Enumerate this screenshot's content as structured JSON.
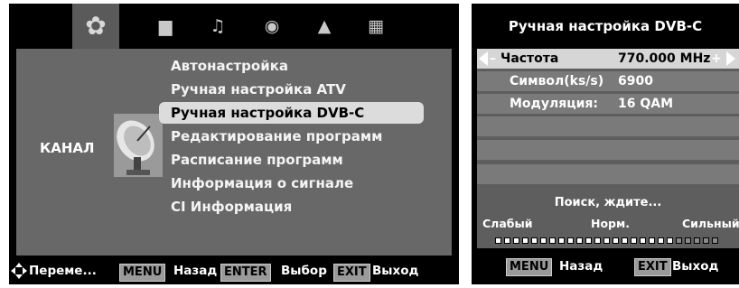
{
  "menu_screen": {
    "tabs": [
      {
        "icon": "gear-icon",
        "glyph": "✿",
        "active": true
      },
      {
        "icon": "monitor-icon",
        "glyph": "▆",
        "active": false
      },
      {
        "icon": "music-icon",
        "glyph": "♫",
        "active": false
      },
      {
        "icon": "clock-icon",
        "glyph": "◉",
        "active": false
      },
      {
        "icon": "lock-icon",
        "glyph": "▲",
        "active": false
      },
      {
        "icon": "grid-icon",
        "glyph": "▦",
        "active": false
      }
    ],
    "section_label": "КАНАЛ",
    "items": [
      {
        "label": "Автонастройка"
      },
      {
        "label": "Ручная настройка ATV"
      },
      {
        "label": "Ручная настройка DVB-C",
        "selected": true
      },
      {
        "label": "Редактирование программ"
      },
      {
        "label": "Расписание программ"
      },
      {
        "label": "Информация о сигнале"
      },
      {
        "label": "CI Информация"
      }
    ],
    "footer": {
      "move_label": "Переме...",
      "menu_key": "MENU",
      "back_label": "Назад",
      "enter_key": "ENTER",
      "select_label": "Выбор",
      "exit_key": "EXIT",
      "exit_label": "Выход"
    }
  },
  "dvbc_screen": {
    "title": "Ручная настройка DVB-C",
    "rows": [
      {
        "label": "Частота",
        "value": "770.000 MHz",
        "selected": true
      },
      {
        "label": "Символ(ks/s)",
        "value": "6900"
      },
      {
        "label": "Модуляция:",
        "value": "16 QAM"
      }
    ],
    "status": "Поиск, ждите...",
    "signal_labels": {
      "weak": "Слабый",
      "normal": "Норм.",
      "strong": "Сильный"
    },
    "signal_level": 0.8,
    "signal_segments": 25,
    "footer": {
      "menu_key": "MENU",
      "back_label": "Назад",
      "exit_key": "EXIT",
      "exit_label": "Выход"
    }
  },
  "colors": {
    "selection": "#dcdcdc",
    "panel": "#686868",
    "background": "#000000"
  }
}
